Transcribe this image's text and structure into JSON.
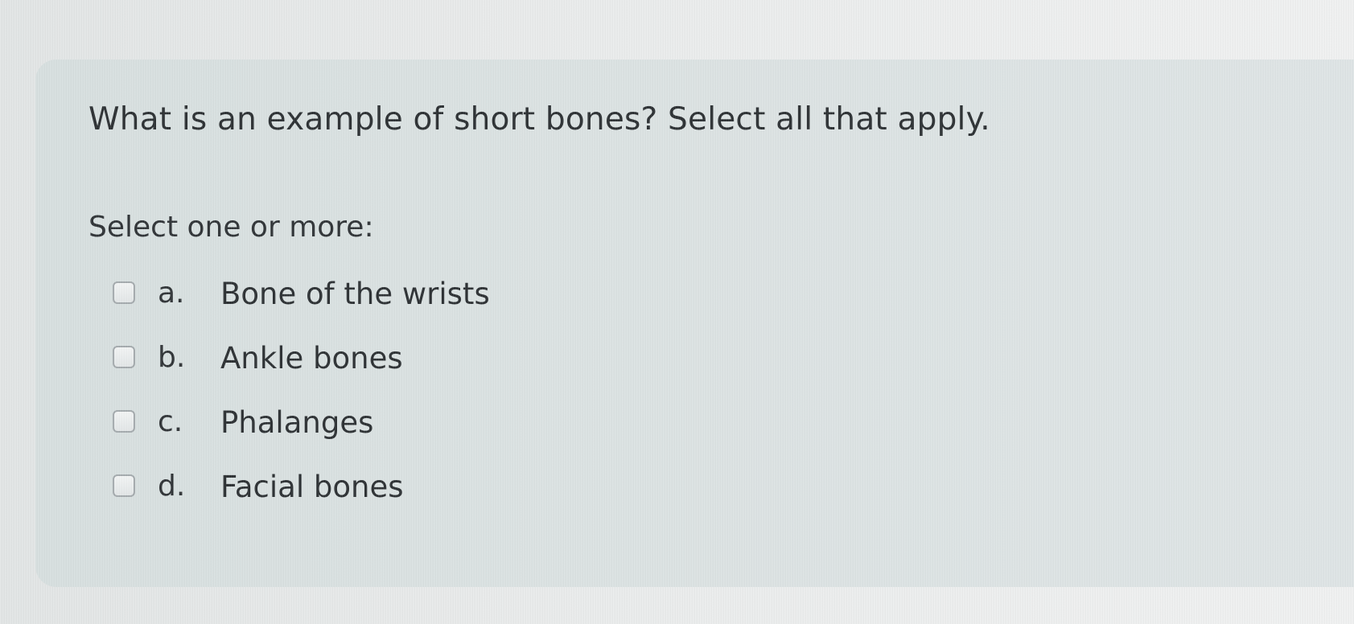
{
  "question": {
    "text": "What is an example of short bones? Select all that apply.",
    "prompt": "Select one or more:"
  },
  "options": [
    {
      "letter": "a.",
      "label": "Bone of the wrists",
      "checked": false
    },
    {
      "letter": "b.",
      "label": "Ankle bones",
      "checked": false
    },
    {
      "letter": "c.",
      "label": "Phalanges",
      "checked": false
    },
    {
      "letter": "d.",
      "label": "Facial bones",
      "checked": false
    }
  ],
  "colors": {
    "card_background": "#dbe2e2",
    "page_background": "#eaecec",
    "text": "#2c3033",
    "checkbox_border": "#a4aaad"
  }
}
